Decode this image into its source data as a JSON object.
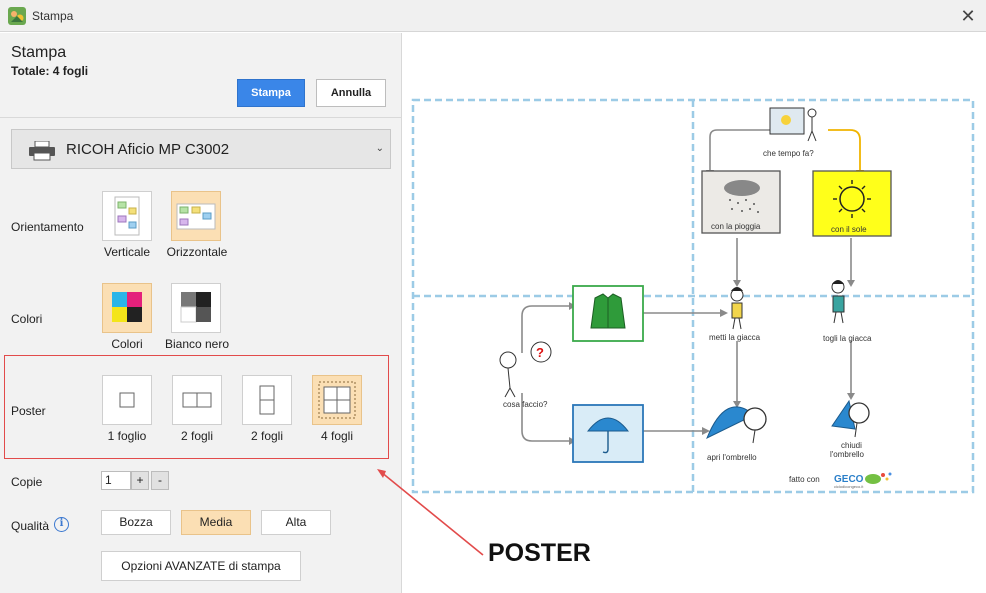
{
  "window": {
    "title": "Stampa"
  },
  "header": {
    "title": "Stampa",
    "total": "Totale: 4 fogli",
    "print_label": "Stampa",
    "cancel_label": "Annulla"
  },
  "printer": {
    "name": "RICOH Aficio MP C3002"
  },
  "orientation": {
    "label": "Orientamento",
    "options": [
      "Verticale",
      "Orizzontale"
    ],
    "selected": "Orizzontale"
  },
  "colors": {
    "label": "Colori",
    "options": [
      "Colori",
      "Bianco nero"
    ],
    "selected": "Colori"
  },
  "poster": {
    "label": "Poster",
    "options": [
      "1 foglio",
      "2 fogli",
      "2 fogli",
      "4 fogli"
    ],
    "selected": "4 fogli"
  },
  "copies": {
    "label": "Copie",
    "value": "1",
    "plus": "+",
    "minus": "-"
  },
  "quality": {
    "label": "Qualità",
    "options": [
      "Bozza",
      "Media",
      "Alta"
    ],
    "selected": "Media"
  },
  "advanced": {
    "label": "Opzioni AVANZATE di stampa"
  },
  "annotation": {
    "text": "POSTER",
    "color": "#e24b4b"
  },
  "preview": {
    "labels": {
      "weather": "che tempo fa?",
      "rain": "con la pioggia",
      "sun": "con il sole",
      "jacket": "metti la giacca",
      "remove_jacket": "togli la giacca",
      "question": "cosa faccio?",
      "open_umbrella": "apri l'ombrello",
      "close_umbrella_1": "chiudi",
      "close_umbrella_2": "l'ombrello",
      "credit": "fatto con",
      "brand": "GECO",
      "site": "ciclodicongeco.it"
    }
  },
  "colors_theme": {
    "accent": "#3a86e8",
    "selected_bg": "#fbdfb4",
    "guide": "#9ccbe6"
  }
}
